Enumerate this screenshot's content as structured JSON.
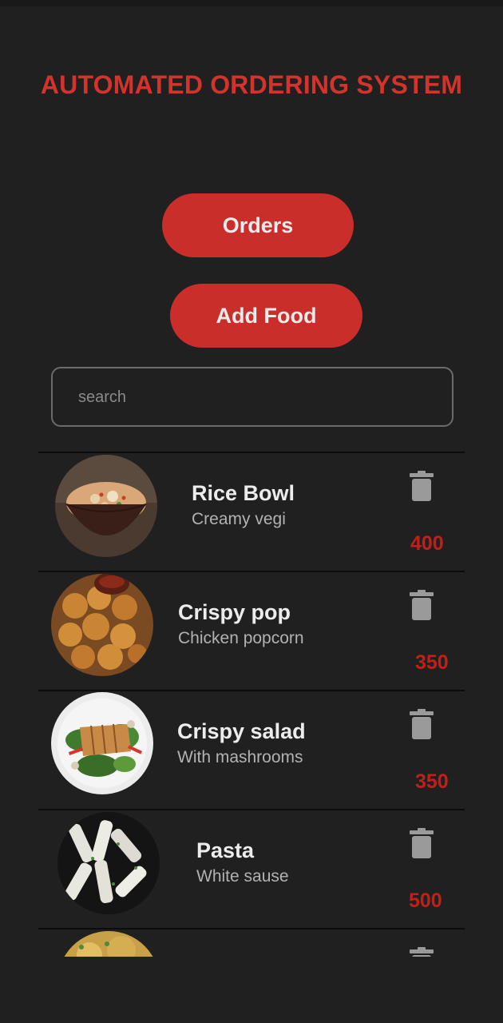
{
  "app": {
    "title": "AUTOMATED ORDERING SYSTEM"
  },
  "buttons": {
    "orders_label": "Orders",
    "add_food_label": "Add Food"
  },
  "search": {
    "placeholder": "search",
    "value": ""
  },
  "colors": {
    "background": "#202020",
    "accent": "#c92e2a",
    "price": "#c21f19",
    "title": "#d2332b"
  },
  "food_items": [
    {
      "name": "Rice Bowl",
      "description": "Creamy vegi",
      "price": "400",
      "icon": "trash-icon"
    },
    {
      "name": "Crispy pop",
      "description": "Chicken popcorn",
      "price": "350",
      "icon": "trash-icon"
    },
    {
      "name": "Crispy salad",
      "description": "With mashrooms",
      "price": "350",
      "icon": "trash-icon"
    },
    {
      "name": "Pasta",
      "description": "White sause",
      "price": "500",
      "icon": "trash-icon"
    },
    {
      "name": "",
      "description": "",
      "price": "",
      "icon": "trash-icon"
    }
  ]
}
